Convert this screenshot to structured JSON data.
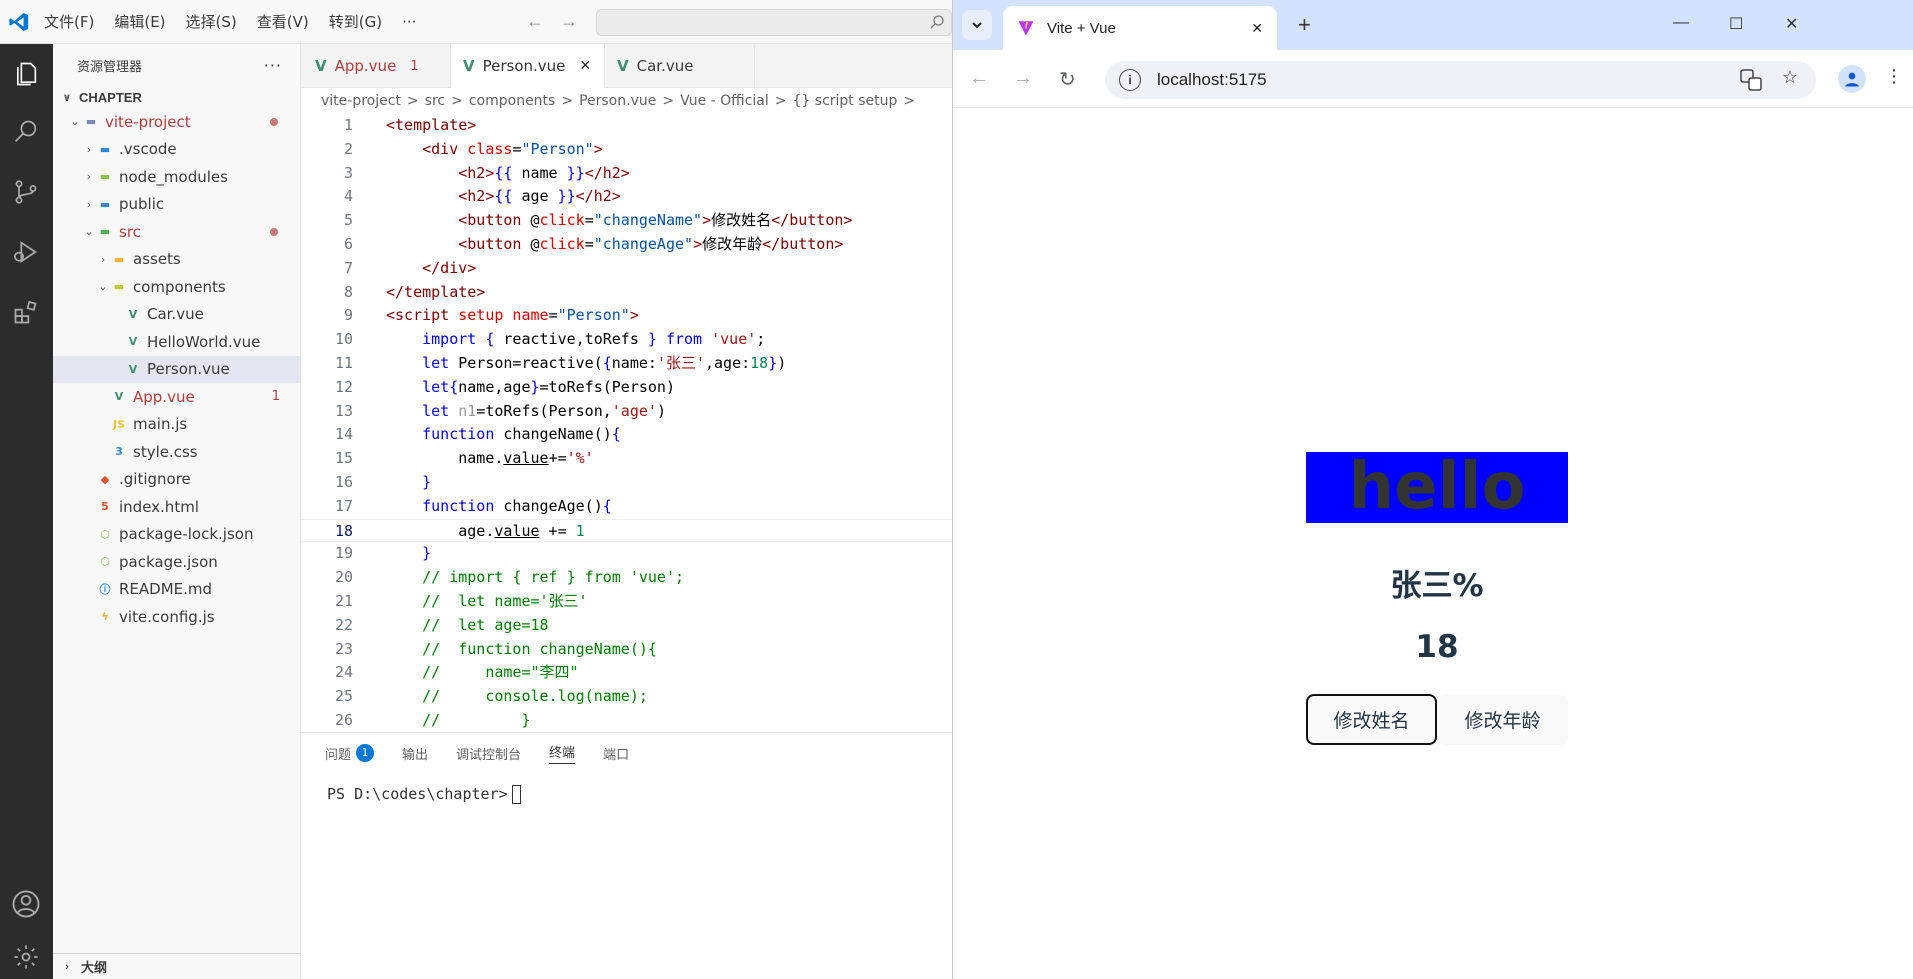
{
  "vscode": {
    "menu": [
      "文件(F)",
      "编辑(E)",
      "选择(S)",
      "查看(V)",
      "转到(G)",
      "···"
    ],
    "explorer_title": "资源管理器",
    "explorer_more": "···",
    "section": "CHAPTER",
    "tree": [
      {
        "label": "vite-project",
        "depth": 0,
        "chevron": "v",
        "icon": "folder-open-icon",
        "color": "#b73b3b",
        "dot": true
      },
      {
        "label": ".vscode",
        "depth": 1,
        "chevron": ">",
        "icon": "folder-vscode-icon"
      },
      {
        "label": "node_modules",
        "depth": 1,
        "chevron": ">",
        "icon": "folder-node-icon"
      },
      {
        "label": "public",
        "depth": 1,
        "chevron": ">",
        "icon": "folder-public-icon"
      },
      {
        "label": "src",
        "depth": 1,
        "chevron": "v",
        "icon": "folder-src-icon",
        "color": "#b73b3b",
        "dot": true
      },
      {
        "label": "assets",
        "depth": 2,
        "chevron": ">",
        "icon": "folder-assets-icon"
      },
      {
        "label": "components",
        "depth": 2,
        "chevron": "v",
        "icon": "folder-components-icon"
      },
      {
        "label": "Car.vue",
        "depth": 3,
        "icon": "vue-icon"
      },
      {
        "label": "HelloWorld.vue",
        "depth": 3,
        "icon": "vue-icon"
      },
      {
        "label": "Person.vue",
        "depth": 3,
        "icon": "vue-icon",
        "selected": true
      },
      {
        "label": "App.vue",
        "depth": 2,
        "icon": "vue-icon",
        "color": "#b73b3b",
        "badge": "1"
      },
      {
        "label": "main.js",
        "depth": 2,
        "icon": "js-icon"
      },
      {
        "label": "style.css",
        "depth": 2,
        "icon": "css-icon"
      },
      {
        "label": ".gitignore",
        "depth": 1,
        "icon": "git-icon"
      },
      {
        "label": "index.html",
        "depth": 1,
        "icon": "html-icon"
      },
      {
        "label": "package-lock.json",
        "depth": 1,
        "icon": "node-json-icon"
      },
      {
        "label": "package.json",
        "depth": 1,
        "icon": "node-json-icon"
      },
      {
        "label": "README.md",
        "depth": 1,
        "icon": "info-icon"
      },
      {
        "label": "vite.config.js",
        "depth": 1,
        "icon": "vite-icon"
      }
    ],
    "outline": "大纲",
    "tabs": [
      {
        "label": "App.vue",
        "count": "1",
        "modified": true
      },
      {
        "label": "Person.vue",
        "active": true,
        "close": "✕"
      },
      {
        "label": "Car.vue"
      }
    ],
    "breadcrumb": [
      "vite-project",
      ">",
      "src",
      ">",
      "components",
      ">",
      "Person.vue",
      ">",
      "Vue - Official",
      ">",
      "{} script setup",
      ">"
    ],
    "current_line": 18,
    "panel_tabs": [
      {
        "label": "问题",
        "badge": "1"
      },
      {
        "label": "输出"
      },
      {
        "label": "调试控制台"
      },
      {
        "label": "终端",
        "active": true
      },
      {
        "label": "端口"
      }
    ],
    "terminal_prompt": "PS D:\\codes\\chapter>"
  },
  "code_lines": [
    [
      [
        "tg",
        "<template>"
      ]
    ],
    [
      [
        "pl",
        "    "
      ],
      [
        "tg",
        "<div "
      ],
      [
        "at",
        "class"
      ],
      [
        "pl",
        "="
      ],
      [
        "st",
        "\"Person\""
      ],
      [
        "tg",
        ">"
      ]
    ],
    [
      [
        "pl",
        "        "
      ],
      [
        "tg",
        "<h2>"
      ],
      [
        "kw",
        "{{"
      ],
      [
        "pl",
        " name "
      ],
      [
        "kw",
        "}}"
      ],
      [
        "tg",
        "</h2>"
      ]
    ],
    [
      [
        "pl",
        "        "
      ],
      [
        "tg",
        "<h2>"
      ],
      [
        "kw",
        "{{"
      ],
      [
        "pl",
        " age "
      ],
      [
        "kw",
        "}}"
      ],
      [
        "tg",
        "</h2>"
      ]
    ],
    [
      [
        "pl",
        "        "
      ],
      [
        "tg",
        "<button "
      ],
      [
        "pl",
        "@"
      ],
      [
        "at",
        "click"
      ],
      [
        "pl",
        "="
      ],
      [
        "st",
        "\"changeName\""
      ],
      [
        "tg",
        ">"
      ],
      [
        "pl",
        "修改姓名"
      ],
      [
        "tg",
        "</button>"
      ]
    ],
    [
      [
        "pl",
        "        "
      ],
      [
        "tg",
        "<button "
      ],
      [
        "pl",
        "@"
      ],
      [
        "at",
        "click"
      ],
      [
        "pl",
        "="
      ],
      [
        "st",
        "\"changeAge\""
      ],
      [
        "tg",
        ">"
      ],
      [
        "pl",
        "修改年龄"
      ],
      [
        "tg",
        "</button>"
      ]
    ],
    [
      [
        "pl",
        "    "
      ],
      [
        "tg",
        "</div>"
      ]
    ],
    [
      [
        "tg",
        "</template>"
      ]
    ],
    [
      [
        "tg",
        "<script "
      ],
      [
        "at",
        "setup name"
      ],
      [
        "pl",
        "="
      ],
      [
        "st",
        "\"Person\""
      ],
      [
        "tg",
        ">"
      ]
    ],
    [
      [
        "pl",
        "    "
      ],
      [
        "kw",
        "import"
      ],
      [
        "pl",
        " "
      ],
      [
        "kw",
        "{"
      ],
      [
        "pl",
        " reactive,toRefs "
      ],
      [
        "kw",
        "}"
      ],
      [
        "pl",
        " "
      ],
      [
        "kw",
        "from"
      ],
      [
        "pl",
        " "
      ],
      [
        "sr",
        "'vue'"
      ],
      [
        "pl",
        ";"
      ]
    ],
    [
      [
        "pl",
        "    "
      ],
      [
        "kw",
        "let"
      ],
      [
        "pl",
        " Person=reactive("
      ],
      [
        "kw",
        "{"
      ],
      [
        "pl",
        "name:"
      ],
      [
        "sr",
        "'张三'"
      ],
      [
        "pl",
        ",age:"
      ],
      [
        "nm",
        "18"
      ],
      [
        "kw",
        "}"
      ],
      [
        "pl",
        ")"
      ]
    ],
    [
      [
        "pl",
        "    "
      ],
      [
        "kw",
        "let"
      ],
      [
        "kw",
        "{"
      ],
      [
        "pl",
        "name,age"
      ],
      [
        "kw",
        "}"
      ],
      [
        "pl",
        "=toRefs(Person)"
      ]
    ],
    [
      [
        "pl",
        "    "
      ],
      [
        "kw",
        "let"
      ],
      [
        "pl",
        " "
      ],
      [
        "dim",
        "n1"
      ],
      [
        "pl",
        "=toRefs(Person,"
      ],
      [
        "sr",
        "'age'"
      ],
      [
        "pl",
        ")"
      ]
    ],
    [
      [
        "pl",
        "    "
      ],
      [
        "kw",
        "function"
      ],
      [
        "pl",
        " changeName()"
      ],
      [
        "kw",
        "{"
      ]
    ],
    [
      [
        "pl",
        "        name."
      ],
      [
        "und",
        "value"
      ],
      [
        "pl",
        "+="
      ],
      [
        "sr",
        "'%'"
      ]
    ],
    [
      [
        "pl",
        "    "
      ],
      [
        "kw",
        "}"
      ]
    ],
    [
      [
        "pl",
        "    "
      ],
      [
        "kw",
        "function"
      ],
      [
        "pl",
        " changeAge()"
      ],
      [
        "kw",
        "{"
      ]
    ],
    [
      [
        "pl",
        "        age."
      ],
      [
        "und",
        "value"
      ],
      [
        "pl",
        " += "
      ],
      [
        "nm",
        "1"
      ]
    ],
    [
      [
        "pl",
        "    "
      ],
      [
        "kw",
        "}"
      ]
    ],
    [
      [
        "cm",
        "    // import { ref } from 'vue';"
      ]
    ],
    [
      [
        "cm",
        "    //  let name='张三'"
      ]
    ],
    [
      [
        "cm",
        "    //  let age=18"
      ]
    ],
    [
      [
        "cm",
        "    //  function changeName(){"
      ]
    ],
    [
      [
        "cm",
        "    //     name=\"李四\""
      ]
    ],
    [
      [
        "cm",
        "    //     console.log(name);"
      ]
    ],
    [
      [
        "cm",
        "    //         }"
      ]
    ]
  ],
  "browser": {
    "tab_title": "Vite + Vue",
    "tab_close": "✕",
    "new_tab": "+",
    "url": "localhost:5175",
    "window_buttons": [
      "—",
      "☐",
      "✕"
    ]
  },
  "app": {
    "hello": "hello",
    "name": "张三%",
    "age": "18",
    "btn_name": "修改姓名",
    "btn_age": "修改年龄"
  },
  "colors": {
    "accent": "#0078d4",
    "vue_green": "#3e8f6e",
    "hello_bg": "#0000ff"
  }
}
